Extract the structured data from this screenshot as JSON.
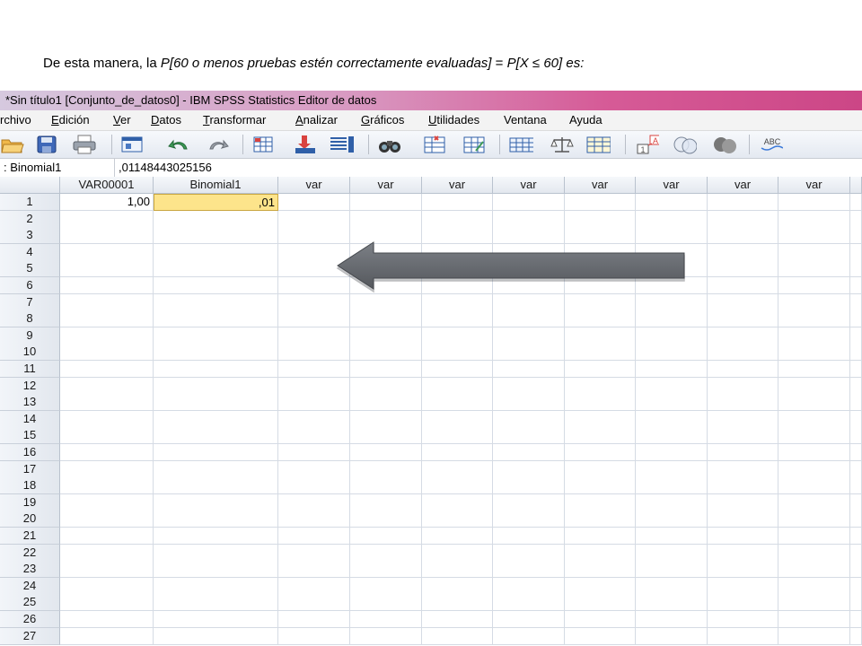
{
  "caption": {
    "prefix": "De esta manera, la ",
    "expr1": "P[60 o menos pruebas estén correctamente evaluadas]",
    "middle": " = ",
    "expr2": "P[X ≤ 60]",
    "suffix": " es:"
  },
  "window": {
    "title": "*Sin título1 [Conjunto_de_datos0] - IBM SPSS Statistics Editor de datos"
  },
  "menu": [
    {
      "u": "",
      "rest": "rchivo"
    },
    {
      "u": "E",
      "rest": "dición"
    },
    {
      "u": "V",
      "rest": "er"
    },
    {
      "u": "D",
      "rest": "atos"
    },
    {
      "u": "T",
      "rest": "ransformar"
    },
    {
      "u": "A",
      "rest": "nalizar"
    },
    {
      "u": "G",
      "rest": "ráficos"
    },
    {
      "u": "U",
      "rest": "tilidades"
    },
    {
      "u": "",
      "rest": "Ventana"
    },
    {
      "u": "",
      "rest": "Ayuda"
    }
  ],
  "toolbar_icons": [
    "open-folder-icon",
    "save-icon",
    "print-icon",
    "dialog-recall-icon",
    "undo-icon",
    "redo-icon",
    "goto-case-icon",
    "goto-variable-icon",
    "variables-icon",
    "find-icon",
    "insert-cases-icon",
    "insert-variable-icon",
    "split-file-icon",
    "weight-cases-icon",
    "select-cases-icon",
    "value-labels-icon",
    "use-sets-icon",
    "show-all-icon",
    "spell-check-icon"
  ],
  "cellbar": {
    "name": ": Binomial1",
    "value": ",01148443025156"
  },
  "columns": [
    "VAR00001",
    "Binomial1",
    "var",
    "var",
    "var",
    "var",
    "var",
    "var",
    "var",
    "var",
    "var"
  ],
  "rows": [
    "1",
    "2",
    "3",
    "4",
    "5",
    "6",
    "7",
    "8",
    "9",
    "10",
    "11",
    "12",
    "13",
    "14",
    "15",
    "16",
    "17",
    "18",
    "19",
    "20",
    "21",
    "22",
    "23",
    "24",
    "25",
    "26",
    "27"
  ],
  "data": {
    "r1_var00001": "1,00",
    "r1_binomial1": ",01"
  },
  "colors": {
    "selected_cell": "#fde48b",
    "arrow": "#6e7176",
    "titlebar_accent": "#cc4686"
  }
}
